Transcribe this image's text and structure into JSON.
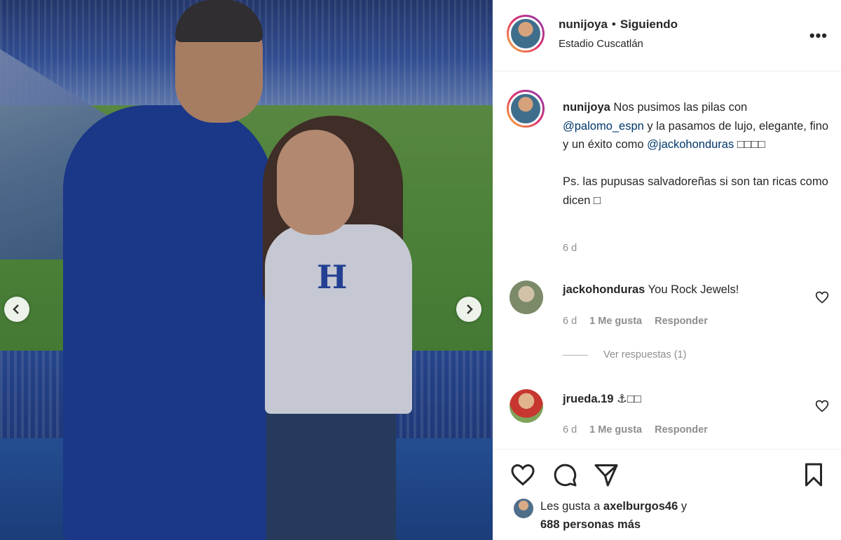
{
  "post": {
    "author": "nunijoya",
    "dot": "•",
    "follow_status": "Siguiendo",
    "location": "Estadio Cuscatlán",
    "more": "•••"
  },
  "caption": {
    "username": "nunijoya",
    "text_1": " Nos pusimos las pilas con",
    "mention_1": "@palomo_espn",
    "text_2": " y la pasamos de lujo, elegante, fino y un éxito como",
    "mention_2": "@jackohonduras",
    "text_3": " □□□□",
    "text_4": "Ps. las pupusas salvadoreñas si son tan ricas como dicen □",
    "time": "6 d"
  },
  "photo": {
    "shirt_letter": "H"
  },
  "comments": [
    {
      "username": "jackohonduras",
      "text": " You Rock Jewels!",
      "time": "6 d",
      "likes": "1 Me gusta",
      "reply": "Responder"
    },
    {
      "username": "jrueda.19",
      "text": " ⚓□□",
      "time": "6 d",
      "likes": "1 Me gusta",
      "reply": "Responder"
    }
  ],
  "view_replies": "Ver respuestas (1)",
  "likes": {
    "prefix": "Les gusta a ",
    "user": "axelburgos46",
    "mid": " y",
    "others": "688 personas más"
  },
  "icons": {
    "heart": "heart-icon",
    "comment": "comment-icon",
    "share": "share-icon",
    "save": "bookmark-icon",
    "prev": "chevron-left-icon",
    "next": "chevron-right-icon"
  }
}
